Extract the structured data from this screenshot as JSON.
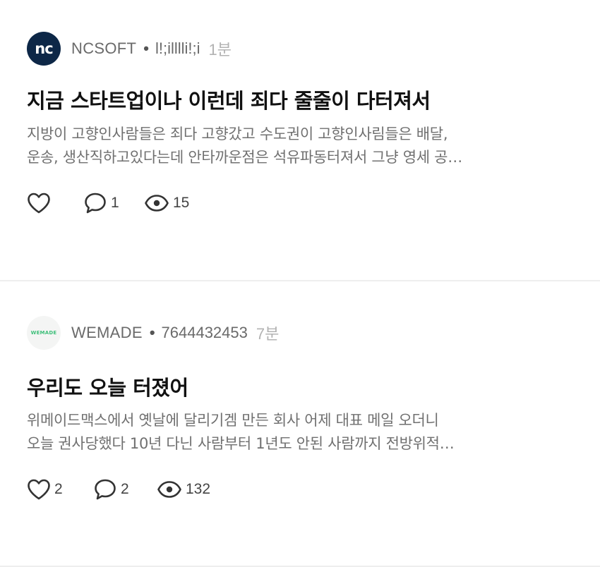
{
  "posts": [
    {
      "avatar_text": "nc",
      "company": "NCSOFT",
      "separator": "•",
      "user": "l!;illlli!;i",
      "time": "1분",
      "title": "지금 스타트업이나 이런데 죄다 줄줄이 다터져서",
      "body_lines": [
        "지방이 고향인사람들은 죄다 고향갔고 수도권이 고향인사림들은 배달,",
        "운송, 생산직하고있다는데  안타까운점은 석유파동터져서 그냥 영세 공…"
      ],
      "likes": "",
      "comments": "1",
      "views": "15"
    },
    {
      "avatar_text": "WEMADE",
      "company": "WEMADE",
      "separator": "•",
      "user": "7644432453",
      "time": "7분",
      "title": "우리도 오늘 터졌어",
      "body_lines": [
        "위메이드맥스에서 옛날에 달리기겜 만든 회사  어제 대표 메일 오더니",
        "오늘 권사당했다  10년 다닌 사람부터 1년도 안된 사람까지  전방위적…"
      ],
      "likes": "2",
      "comments": "2",
      "views": "132"
    }
  ],
  "icons": {
    "like": "heart-outline-icon",
    "comment": "speech-bubble-icon",
    "views": "eye-icon"
  },
  "colors": {
    "nc_brand": "#0d2747",
    "wemade_brand": "#3fbf7a",
    "text_primary": "#111111",
    "text_secondary": "#707070",
    "time": "#b3b3b3",
    "divider": "#eeeeee"
  }
}
